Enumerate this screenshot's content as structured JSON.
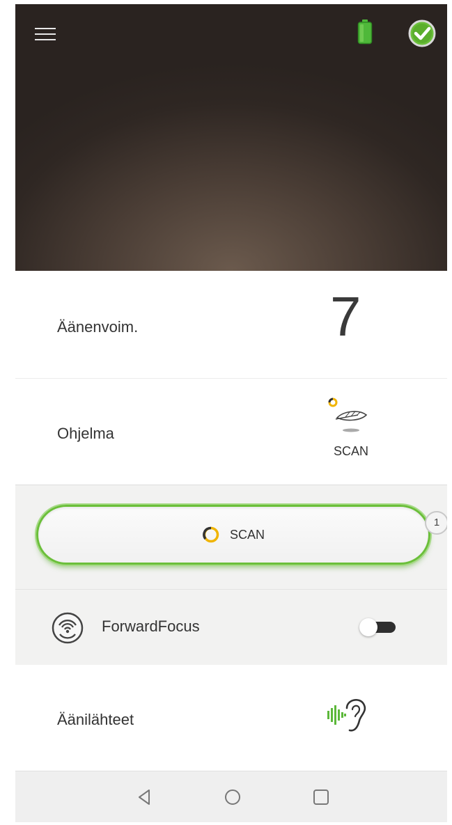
{
  "header": {
    "menu_icon": "hamburger-menu-icon",
    "battery_icon": "battery-full-icon",
    "battery_color": "#4fb83a",
    "status_icon": "check-circle-icon",
    "status_color": "#6bbf3a"
  },
  "volume": {
    "label": "Äänenvoim.",
    "value": "7"
  },
  "program": {
    "label": "Ohjelma",
    "icon": "feather-scan-icon",
    "value": "SCAN"
  },
  "scan_button": {
    "label": "SCAN",
    "icon": "loading-ring-icon",
    "badge": "1",
    "accent_color": "#6bbf3a"
  },
  "forward_focus": {
    "label": "ForwardFocus",
    "icon": "forward-focus-icon",
    "enabled": false
  },
  "sound_sources": {
    "label": "Äänilähteet",
    "icon": "ear-sound-icon",
    "icon_color": "#5cb83a"
  },
  "navbar": {
    "back_icon": "back-triangle-icon",
    "home_icon": "home-circle-icon",
    "recents_icon": "recents-square-icon"
  }
}
